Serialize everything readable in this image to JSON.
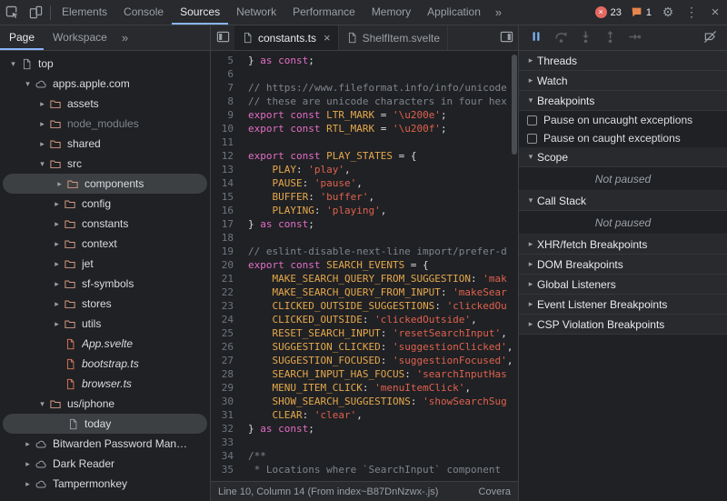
{
  "colors": {
    "accent_blue": "#8ab4f8",
    "error_red": "#e46962",
    "issue_orange": "#e8854c",
    "selection_gray": "#3c4043",
    "background": "#202124",
    "toolbar": "#292a2d"
  },
  "top_toolbar": {
    "tabs": [
      "Elements",
      "Console",
      "Sources",
      "Network",
      "Performance",
      "Memory",
      "Application"
    ],
    "selected_tab": "Sources",
    "overflow_chevron": "»",
    "error_count": "23",
    "issue_count": "1"
  },
  "navigator": {
    "tabs": [
      "Page",
      "Workspace"
    ],
    "selected_tab": "Page",
    "overflow_chevron": "»",
    "tree": [
      {
        "label": "top",
        "depth": 0,
        "icon": "doc",
        "arrow": "open"
      },
      {
        "label": "apps.apple.com",
        "depth": 1,
        "icon": "cloud",
        "arrow": "open"
      },
      {
        "label": "assets",
        "depth": 2,
        "icon": "folder",
        "arrow": "closed"
      },
      {
        "label": "node_modules",
        "depth": 2,
        "icon": "folder",
        "arrow": "closed",
        "dim": true
      },
      {
        "label": "shared",
        "depth": 2,
        "icon": "folder",
        "arrow": "closed"
      },
      {
        "label": "src",
        "depth": 2,
        "icon": "folder",
        "arrow": "open"
      },
      {
        "label": "components",
        "depth": 3,
        "icon": "folder",
        "arrow": "closed",
        "selected": true
      },
      {
        "label": "config",
        "depth": 3,
        "icon": "folder",
        "arrow": "closed"
      },
      {
        "label": "constants",
        "depth": 3,
        "icon": "folder",
        "arrow": "closed"
      },
      {
        "label": "context",
        "depth": 3,
        "icon": "folder",
        "arrow": "closed"
      },
      {
        "label": "jet",
        "depth": 3,
        "icon": "folder",
        "arrow": "closed"
      },
      {
        "label": "sf-symbols",
        "depth": 3,
        "icon": "folder",
        "arrow": "closed"
      },
      {
        "label": "stores",
        "depth": 3,
        "icon": "folder",
        "arrow": "closed"
      },
      {
        "label": "utils",
        "depth": 3,
        "icon": "folder",
        "arrow": "closed"
      },
      {
        "label": "App.svelte",
        "depth": 3,
        "icon": "file",
        "arrow": "none",
        "italic": true
      },
      {
        "label": "bootstrap.ts",
        "depth": 3,
        "icon": "file",
        "arrow": "none",
        "italic": true
      },
      {
        "label": "browser.ts",
        "depth": 3,
        "icon": "file",
        "arrow": "none",
        "italic": true
      },
      {
        "label": "us/iphone",
        "depth": 2,
        "icon": "folder",
        "arrow": "open"
      },
      {
        "label": "today",
        "depth": 3,
        "icon": "doc",
        "arrow": "none",
        "selected": true
      },
      {
        "label": "Bitwarden Password Man…",
        "depth": 1,
        "icon": "cloud",
        "arrow": "closed"
      },
      {
        "label": "Dark Reader",
        "depth": 1,
        "icon": "cloud",
        "arrow": "closed"
      },
      {
        "label": "Tampermonkey",
        "depth": 1,
        "icon": "cloud",
        "arrow": "closed"
      }
    ]
  },
  "editor": {
    "tabs": [
      {
        "label": "constants.ts",
        "active": true,
        "closable": true
      },
      {
        "label": "ShelfItem.svelte",
        "active": false,
        "closable": false
      }
    ],
    "status_left": "Line 10, Column 14 (From index~B87DnNzwx-.js)",
    "status_right": "Covera",
    "code_lines": [
      {
        "n": 5,
        "t": [
          [
            "} ",
            "p"
          ],
          [
            "as const",
            "k"
          ],
          [
            ";",
            "p"
          ]
        ]
      },
      {
        "n": 6,
        "t": []
      },
      {
        "n": 7,
        "t": [
          [
            "// https://www.fileformat.info/info/unicode",
            "c"
          ]
        ]
      },
      {
        "n": 8,
        "t": [
          [
            "// these are unicode characters in four hex",
            "c"
          ]
        ]
      },
      {
        "n": 9,
        "t": [
          [
            "export const ",
            "k"
          ],
          [
            "LTR_MARK",
            "d"
          ],
          [
            " = ",
            "p"
          ],
          [
            "'\\u200e'",
            "s"
          ],
          [
            ";",
            "p"
          ]
        ]
      },
      {
        "n": 10,
        "t": [
          [
            "export const ",
            "k"
          ],
          [
            "RTL_MARK",
            "d"
          ],
          [
            " = ",
            "p"
          ],
          [
            "'\\u200f'",
            "s"
          ],
          [
            ";",
            "p"
          ]
        ]
      },
      {
        "n": 11,
        "t": []
      },
      {
        "n": 12,
        "t": [
          [
            "export const ",
            "k"
          ],
          [
            "PLAY_STATES",
            "d"
          ],
          [
            " = {",
            "p"
          ]
        ]
      },
      {
        "n": 13,
        "t": [
          [
            "    ",
            "p"
          ],
          [
            "PLAY",
            "d"
          ],
          [
            ": ",
            "p"
          ],
          [
            "'play'",
            "s"
          ],
          [
            ",",
            "p"
          ]
        ]
      },
      {
        "n": 14,
        "t": [
          [
            "    ",
            "p"
          ],
          [
            "PAUSE",
            "d"
          ],
          [
            ": ",
            "p"
          ],
          [
            "'pause'",
            "s"
          ],
          [
            ",",
            "p"
          ]
        ]
      },
      {
        "n": 15,
        "t": [
          [
            "    ",
            "p"
          ],
          [
            "BUFFER",
            "d"
          ],
          [
            ": ",
            "p"
          ],
          [
            "'buffer'",
            "s"
          ],
          [
            ",",
            "p"
          ]
        ]
      },
      {
        "n": 16,
        "t": [
          [
            "    ",
            "p"
          ],
          [
            "PLAYING",
            "d"
          ],
          [
            ": ",
            "p"
          ],
          [
            "'playing'",
            "s"
          ],
          [
            ",",
            "p"
          ]
        ]
      },
      {
        "n": 17,
        "t": [
          [
            "} ",
            "p"
          ],
          [
            "as const",
            "k"
          ],
          [
            ";",
            "p"
          ]
        ]
      },
      {
        "n": 18,
        "t": []
      },
      {
        "n": 19,
        "t": [
          [
            "// eslint-disable-next-line import/prefer-d",
            "c"
          ]
        ]
      },
      {
        "n": 20,
        "t": [
          [
            "export const ",
            "k"
          ],
          [
            "SEARCH_EVENTS",
            "d"
          ],
          [
            " = {",
            "p"
          ]
        ]
      },
      {
        "n": 21,
        "t": [
          [
            "    ",
            "p"
          ],
          [
            "MAKE_SEARCH_QUERY_FROM_SUGGESTION",
            "d"
          ],
          [
            ": ",
            "p"
          ],
          [
            "'mak",
            "s"
          ]
        ]
      },
      {
        "n": 22,
        "t": [
          [
            "    ",
            "p"
          ],
          [
            "MAKE_SEARCH_QUERY_FROM_INPUT",
            "d"
          ],
          [
            ": ",
            "p"
          ],
          [
            "'makeSear",
            "s"
          ]
        ]
      },
      {
        "n": 23,
        "t": [
          [
            "    ",
            "p"
          ],
          [
            "CLICKED_OUTSIDE_SUGGESTIONS",
            "d"
          ],
          [
            ": ",
            "p"
          ],
          [
            "'clickedOu",
            "s"
          ]
        ]
      },
      {
        "n": 24,
        "t": [
          [
            "    ",
            "p"
          ],
          [
            "CLICKED_OUTSIDE",
            "d"
          ],
          [
            ": ",
            "p"
          ],
          [
            "'clickedOutside'",
            "s"
          ],
          [
            ",",
            "p"
          ]
        ]
      },
      {
        "n": 25,
        "t": [
          [
            "    ",
            "p"
          ],
          [
            "RESET_SEARCH_INPUT",
            "d"
          ],
          [
            ": ",
            "p"
          ],
          [
            "'resetSearchInput'",
            "s"
          ],
          [
            ",",
            "p"
          ]
        ]
      },
      {
        "n": 26,
        "t": [
          [
            "    ",
            "p"
          ],
          [
            "SUGGESTION_CLICKED",
            "d"
          ],
          [
            ": ",
            "p"
          ],
          [
            "'suggestionClicked'",
            "s"
          ],
          [
            ",",
            "p"
          ]
        ]
      },
      {
        "n": 27,
        "t": [
          [
            "    ",
            "p"
          ],
          [
            "SUGGESTION_FOCUSED",
            "d"
          ],
          [
            ": ",
            "p"
          ],
          [
            "'suggestionFocused'",
            "s"
          ],
          [
            ",",
            "p"
          ]
        ]
      },
      {
        "n": 28,
        "t": [
          [
            "    ",
            "p"
          ],
          [
            "SEARCH_INPUT_HAS_FOCUS",
            "d"
          ],
          [
            ": ",
            "p"
          ],
          [
            "'searchInputHas",
            "s"
          ]
        ]
      },
      {
        "n": 29,
        "t": [
          [
            "    ",
            "p"
          ],
          [
            "MENU_ITEM_CLICK",
            "d"
          ],
          [
            ": ",
            "p"
          ],
          [
            "'menuItemClick'",
            "s"
          ],
          [
            ",",
            "p"
          ]
        ]
      },
      {
        "n": 30,
        "t": [
          [
            "    ",
            "p"
          ],
          [
            "SHOW_SEARCH_SUGGESTIONS",
            "d"
          ],
          [
            ": ",
            "p"
          ],
          [
            "'showSearchSug",
            "s"
          ]
        ]
      },
      {
        "n": 31,
        "t": [
          [
            "    ",
            "p"
          ],
          [
            "CLEAR",
            "d"
          ],
          [
            ": ",
            "p"
          ],
          [
            "'clear'",
            "s"
          ],
          [
            ",",
            "p"
          ]
        ]
      },
      {
        "n": 32,
        "t": [
          [
            "} ",
            "p"
          ],
          [
            "as const",
            "k"
          ],
          [
            ";",
            "p"
          ]
        ]
      },
      {
        "n": 33,
        "t": []
      },
      {
        "n": 34,
        "t": [
          [
            "/**",
            "c"
          ]
        ]
      },
      {
        "n": 35,
        "t": [
          [
            " * Locations where `SearchInput` component",
            "c"
          ]
        ]
      }
    ]
  },
  "debugger": {
    "sections": [
      {
        "label": "Threads",
        "expanded": false
      },
      {
        "label": "Watch",
        "expanded": false
      },
      {
        "label": "Breakpoints",
        "expanded": true,
        "checkboxes": [
          "Pause on uncaught exceptions",
          "Pause on caught exceptions"
        ]
      },
      {
        "label": "Scope",
        "expanded": true,
        "empty": "Not paused"
      },
      {
        "label": "Call Stack",
        "expanded": true,
        "empty": "Not paused"
      },
      {
        "label": "XHR/fetch Breakpoints",
        "expanded": false
      },
      {
        "label": "DOM Breakpoints",
        "expanded": false
      },
      {
        "label": "Global Listeners",
        "expanded": false
      },
      {
        "label": "Event Listener Breakpoints",
        "expanded": false
      },
      {
        "label": "CSP Violation Breakpoints",
        "expanded": false
      }
    ]
  }
}
